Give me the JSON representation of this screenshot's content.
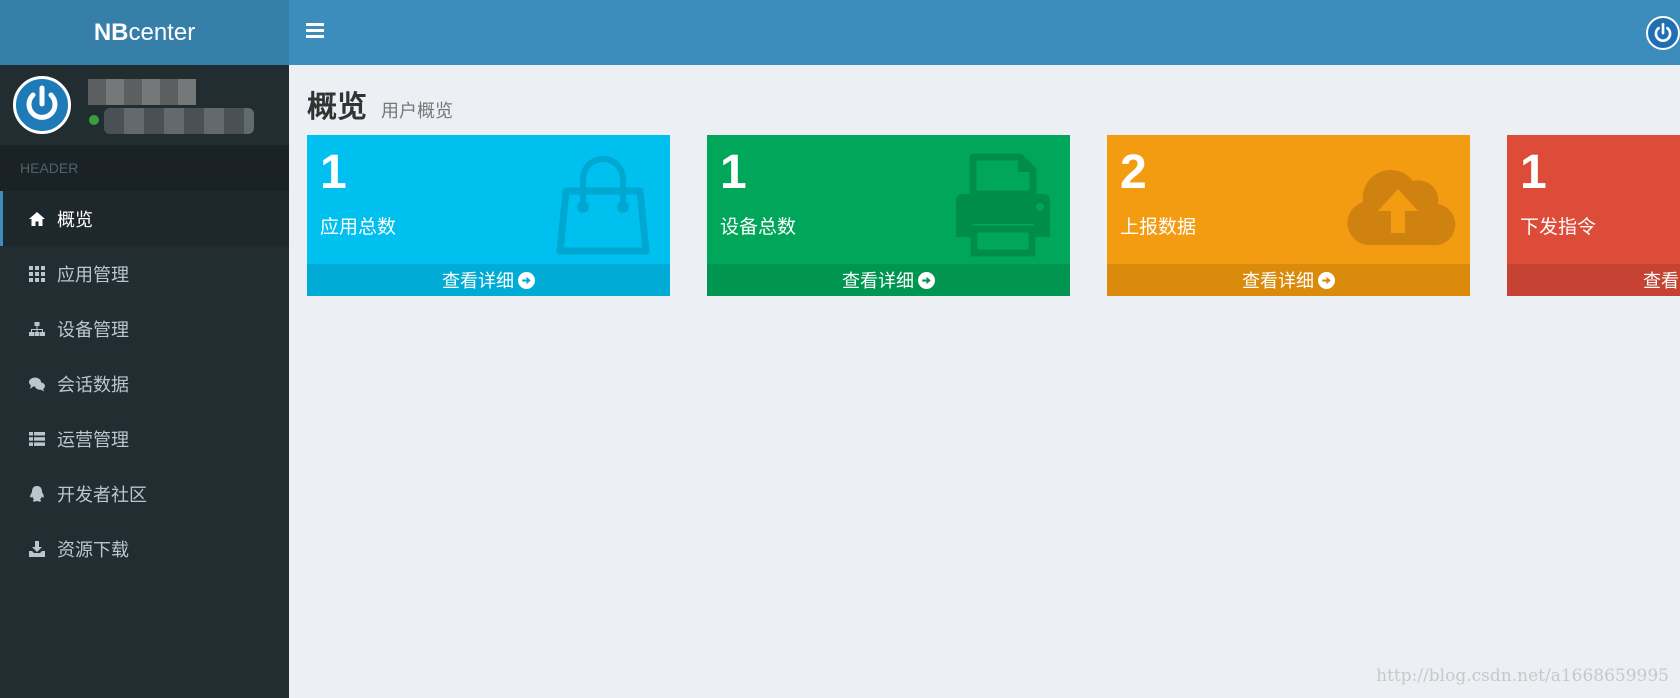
{
  "app": {
    "logo_bold": "NB",
    "logo_rest": "center"
  },
  "sidebar": {
    "header_label": "HEADER",
    "items": [
      {
        "label": "概览",
        "icon": "home-icon",
        "active": true
      },
      {
        "label": "应用管理",
        "icon": "grid-icon"
      },
      {
        "label": "设备管理",
        "icon": "sitemap-icon"
      },
      {
        "label": "会话数据",
        "icon": "comments-icon"
      },
      {
        "label": "运营管理",
        "icon": "list-icon"
      },
      {
        "label": "开发者社区",
        "icon": "qq-icon"
      },
      {
        "label": "资源下载",
        "icon": "download-icon"
      }
    ]
  },
  "page": {
    "title": "概览",
    "subtitle": "用户概览"
  },
  "stats": [
    {
      "value": "1",
      "label": "应用总数",
      "link": "查看详细",
      "icon": "shopping-bag-icon",
      "color": "#00c0ef"
    },
    {
      "value": "1",
      "label": "设备总数",
      "link": "查看详细",
      "icon": "printer-icon",
      "color": "#00a65a"
    },
    {
      "value": "2",
      "label": "上报数据",
      "link": "查看详细",
      "icon": "cloud-upload-icon",
      "color": "#f39c12"
    },
    {
      "value": "1",
      "label": "下发指令",
      "link": "查看",
      "icon": "",
      "color": "#dd4b39"
    }
  ],
  "watermark": "http://blog.csdn.net/a1668659995"
}
